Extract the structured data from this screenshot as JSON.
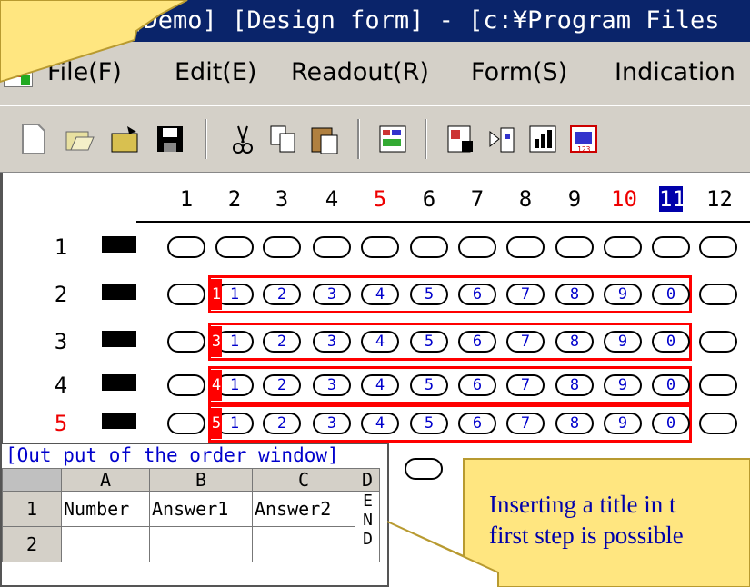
{
  "window": {
    "title_visible": "VIEW [Demo] [Design form] - [c:¥Program Files"
  },
  "menu": {
    "items": [
      "File(F)",
      "Edit(E)",
      "Readout(R)",
      "Form(S)",
      "Indication"
    ]
  },
  "toolbar": {
    "icons": [
      "new-icon",
      "open-icon",
      "open-folder-icon",
      "save-icon",
      "cut-icon",
      "copy-icon",
      "paste-icon",
      "grid-layout-icon",
      "form-layout-icon",
      "import-icon",
      "chart-icon",
      "numbered-chart-icon"
    ]
  },
  "design": {
    "column_numbers": [
      "1",
      "2",
      "3",
      "4",
      "5",
      "6",
      "7",
      "8",
      "9",
      "10",
      "11",
      "12"
    ],
    "column_states": [
      "normal",
      "normal",
      "normal",
      "normal",
      "red",
      "normal",
      "normal",
      "normal",
      "normal",
      "red",
      "selected",
      "normal"
    ],
    "row_numbers": [
      "1",
      "2",
      "3",
      "4",
      "5"
    ],
    "row_states": [
      "normal",
      "normal",
      "normal",
      "normal",
      "red"
    ],
    "answer_rows": [
      {
        "tag": "1",
        "bubbles": [
          "1",
          "2",
          "3",
          "4",
          "5",
          "6",
          "7",
          "8",
          "9",
          "0"
        ]
      },
      {
        "tag": "3",
        "bubbles": [
          "1",
          "2",
          "3",
          "4",
          "5",
          "6",
          "7",
          "8",
          "9",
          "0"
        ]
      },
      {
        "tag": "4",
        "bubbles": [
          "1",
          "2",
          "3",
          "4",
          "5",
          "6",
          "7",
          "8",
          "9",
          "0"
        ]
      },
      {
        "tag": "5",
        "bubbles": [
          "1",
          "2",
          "3",
          "4",
          "5",
          "6",
          "7",
          "8",
          "9",
          "0"
        ]
      }
    ]
  },
  "output_window": {
    "title": "[Out put of the order window]",
    "columns": [
      "A",
      "B",
      "C",
      "D"
    ],
    "rows": [
      {
        "num": "1",
        "cells": [
          "Number",
          "Answer1",
          "Answer2"
        ]
      },
      {
        "num": "2",
        "cells": [
          "",
          "",
          ""
        ]
      }
    ],
    "end_marker": "END"
  },
  "callout": {
    "line1": "Inserting a title in t",
    "line2": "first step is possible"
  },
  "colors": {
    "title_bg": "#0a246a",
    "highlight_red": "#ff0000",
    "bubble_blue": "#0000cc",
    "callout_fill": "#ffe680"
  }
}
